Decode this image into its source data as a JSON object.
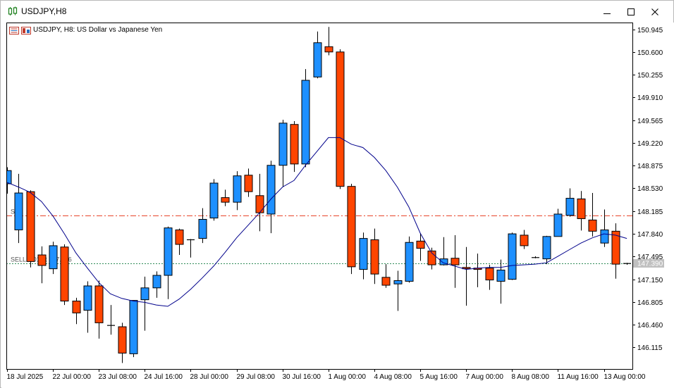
{
  "window": {
    "title": "USDJPY,H8",
    "minimize_icon": "minimize-icon",
    "maximize_icon": "maximize-icon",
    "close_icon": "close-icon"
  },
  "chart_data": {
    "type": "candlestick",
    "title": "USDJPY, H8:  US Dollar vs Japanese Yen",
    "colors": {
      "bull_fill": "#1e90ff",
      "bear_fill": "#ff4500",
      "outline": "#000000",
      "ma_line": "#00008b",
      "sell_level_line": "#e8452a",
      "bid_line": "#2e8b57",
      "price_label_bg": "#c0c0c0"
    },
    "y_axis": {
      "ticks": [
        "150.945",
        "150.600",
        "150.255",
        "149.910",
        "149.565",
        "149.220",
        "148.875",
        "148.530",
        "148.185",
        "147.840",
        "147.495",
        "147.150",
        "146.805",
        "146.460",
        "146.115"
      ],
      "range": [
        145.83,
        151.08
      ]
    },
    "x_axis": {
      "ticks": [
        "18 Jul 2025",
        "22 Jul 00:00",
        "23 Jul 08:00",
        "24 Jul 16:00",
        "28 Jul 00:00",
        "29 Jul 08:00",
        "30 Jul 16:00",
        "1 Aug 00:00",
        "4 Aug 08:00",
        "5 Aug 16:00",
        "7 Aug 00:00",
        "8 Aug 08:00",
        "11 Aug 16:00",
        "13 Aug 00:00"
      ],
      "tick_bar_index": [
        0,
        4,
        8,
        12,
        16,
        20,
        24,
        28,
        32,
        36,
        40,
        44,
        48,
        52
      ]
    },
    "candles": [
      {
        "o": 148.6,
        "h": 148.85,
        "l": 148.45,
        "c": 148.8
      },
      {
        "o": 147.9,
        "h": 148.75,
        "l": 147.7,
        "c": 148.46
      },
      {
        "o": 148.48,
        "h": 148.5,
        "l": 147.33,
        "c": 147.42
      },
      {
        "o": 147.52,
        "h": 147.65,
        "l": 147.09,
        "c": 147.36
      },
      {
        "o": 147.31,
        "h": 147.72,
        "l": 147.23,
        "c": 147.66
      },
      {
        "o": 147.64,
        "h": 147.68,
        "l": 146.76,
        "c": 146.82
      },
      {
        "o": 146.82,
        "h": 146.87,
        "l": 146.47,
        "c": 146.64
      },
      {
        "o": 146.68,
        "h": 147.12,
        "l": 146.34,
        "c": 147.05
      },
      {
        "o": 147.05,
        "h": 147.13,
        "l": 146.25,
        "c": 146.49
      },
      {
        "o": 146.45,
        "h": 146.76,
        "l": 146.31,
        "c": 146.44
      },
      {
        "o": 146.43,
        "h": 146.49,
        "l": 145.88,
        "c": 146.03
      },
      {
        "o": 146.02,
        "h": 146.83,
        "l": 145.97,
        "c": 146.83
      },
      {
        "o": 146.84,
        "h": 147.19,
        "l": 146.37,
        "c": 147.02
      },
      {
        "o": 147.02,
        "h": 147.27,
        "l": 146.87,
        "c": 147.21
      },
      {
        "o": 147.21,
        "h": 147.95,
        "l": 146.85,
        "c": 147.93
      },
      {
        "o": 147.9,
        "h": 147.92,
        "l": 147.52,
        "c": 147.68
      },
      {
        "o": 147.75,
        "h": 147.76,
        "l": 147.48,
        "c": 147.75
      },
      {
        "o": 147.77,
        "h": 148.23,
        "l": 147.7,
        "c": 148.06
      },
      {
        "o": 148.08,
        "h": 148.67,
        "l": 148.04,
        "c": 148.61
      },
      {
        "o": 148.39,
        "h": 148.51,
        "l": 148.26,
        "c": 148.32
      },
      {
        "o": 148.32,
        "h": 148.79,
        "l": 148.2,
        "c": 148.72
      },
      {
        "o": 148.73,
        "h": 148.83,
        "l": 148.4,
        "c": 148.48
      },
      {
        "o": 148.42,
        "h": 148.75,
        "l": 147.88,
        "c": 148.16
      },
      {
        "o": 148.14,
        "h": 148.95,
        "l": 147.85,
        "c": 148.88
      },
      {
        "o": 148.88,
        "h": 149.57,
        "l": 148.55,
        "c": 149.52
      },
      {
        "o": 149.5,
        "h": 149.55,
        "l": 148.78,
        "c": 148.9
      },
      {
        "o": 148.9,
        "h": 150.34,
        "l": 148.85,
        "c": 150.17
      },
      {
        "o": 150.22,
        "h": 150.91,
        "l": 150.2,
        "c": 150.74
      },
      {
        "o": 150.68,
        "h": 150.98,
        "l": 150.55,
        "c": 150.6
      },
      {
        "o": 150.6,
        "h": 150.64,
        "l": 148.52,
        "c": 148.56
      },
      {
        "o": 148.56,
        "h": 148.6,
        "l": 147.23,
        "c": 147.34
      },
      {
        "o": 147.3,
        "h": 147.86,
        "l": 147.15,
        "c": 147.77
      },
      {
        "o": 147.75,
        "h": 147.92,
        "l": 147.08,
        "c": 147.23
      },
      {
        "o": 147.18,
        "h": 147.38,
        "l": 147.02,
        "c": 147.06
      },
      {
        "o": 147.08,
        "h": 147.28,
        "l": 146.67,
        "c": 147.13
      },
      {
        "o": 147.12,
        "h": 147.8,
        "l": 147.1,
        "c": 147.71
      },
      {
        "o": 147.73,
        "h": 147.85,
        "l": 147.43,
        "c": 147.62
      },
      {
        "o": 147.58,
        "h": 147.63,
        "l": 147.3,
        "c": 147.37
      },
      {
        "o": 147.37,
        "h": 147.79,
        "l": 147.36,
        "c": 147.46
      },
      {
        "o": 147.47,
        "h": 147.82,
        "l": 147.02,
        "c": 147.37
      },
      {
        "o": 147.33,
        "h": 147.64,
        "l": 146.75,
        "c": 147.31
      },
      {
        "o": 147.32,
        "h": 147.54,
        "l": 147.03,
        "c": 147.3
      },
      {
        "o": 147.32,
        "h": 147.37,
        "l": 146.99,
        "c": 147.14
      },
      {
        "o": 147.12,
        "h": 147.45,
        "l": 146.78,
        "c": 147.29
      },
      {
        "o": 147.15,
        "h": 147.86,
        "l": 147.14,
        "c": 147.84
      },
      {
        "o": 147.82,
        "h": 147.9,
        "l": 147.61,
        "c": 147.66
      },
      {
        "o": 147.48,
        "h": 147.5,
        "l": 147.47,
        "c": 147.48
      },
      {
        "o": 147.46,
        "h": 147.81,
        "l": 147.38,
        "c": 147.8
      },
      {
        "o": 147.8,
        "h": 148.22,
        "l": 147.8,
        "c": 148.14
      },
      {
        "o": 148.12,
        "h": 148.53,
        "l": 148.1,
        "c": 148.38
      },
      {
        "o": 148.37,
        "h": 148.49,
        "l": 147.89,
        "c": 148.07
      },
      {
        "o": 148.05,
        "h": 148.46,
        "l": 147.8,
        "c": 147.88
      },
      {
        "o": 147.7,
        "h": 148.21,
        "l": 147.64,
        "c": 147.9
      },
      {
        "o": 147.88,
        "h": 148.0,
        "l": 147.16,
        "c": 147.38
      },
      {
        "o": 147.38,
        "h": 147.4,
        "l": 147.37,
        "c": 147.39
      }
    ],
    "moving_average": [
      148.62,
      148.55,
      148.47,
      148.33,
      148.11,
      147.84,
      147.55,
      147.32,
      147.1,
      146.93,
      146.86,
      146.82,
      146.8,
      146.76,
      146.74,
      146.85,
      147.0,
      147.17,
      147.35,
      147.56,
      147.78,
      147.97,
      148.16,
      148.37,
      148.55,
      148.65,
      148.88,
      149.09,
      149.3,
      149.3,
      149.2,
      149.15,
      149.0,
      148.8,
      148.55,
      148.25,
      147.85,
      147.55,
      147.4,
      147.35,
      147.3,
      147.32,
      147.33,
      147.33,
      147.36,
      147.37,
      147.38,
      147.4,
      147.5,
      147.6,
      147.7,
      147.78,
      147.84,
      147.82,
      147.77
    ],
    "levels": [
      {
        "label": "S",
        "price": 148.12,
        "style": "dash-dot"
      },
      {
        "label": "SELL 0.01 at 147.406",
        "price": 147.39,
        "style": "dotted"
      }
    ],
    "current_price": "147.390"
  }
}
